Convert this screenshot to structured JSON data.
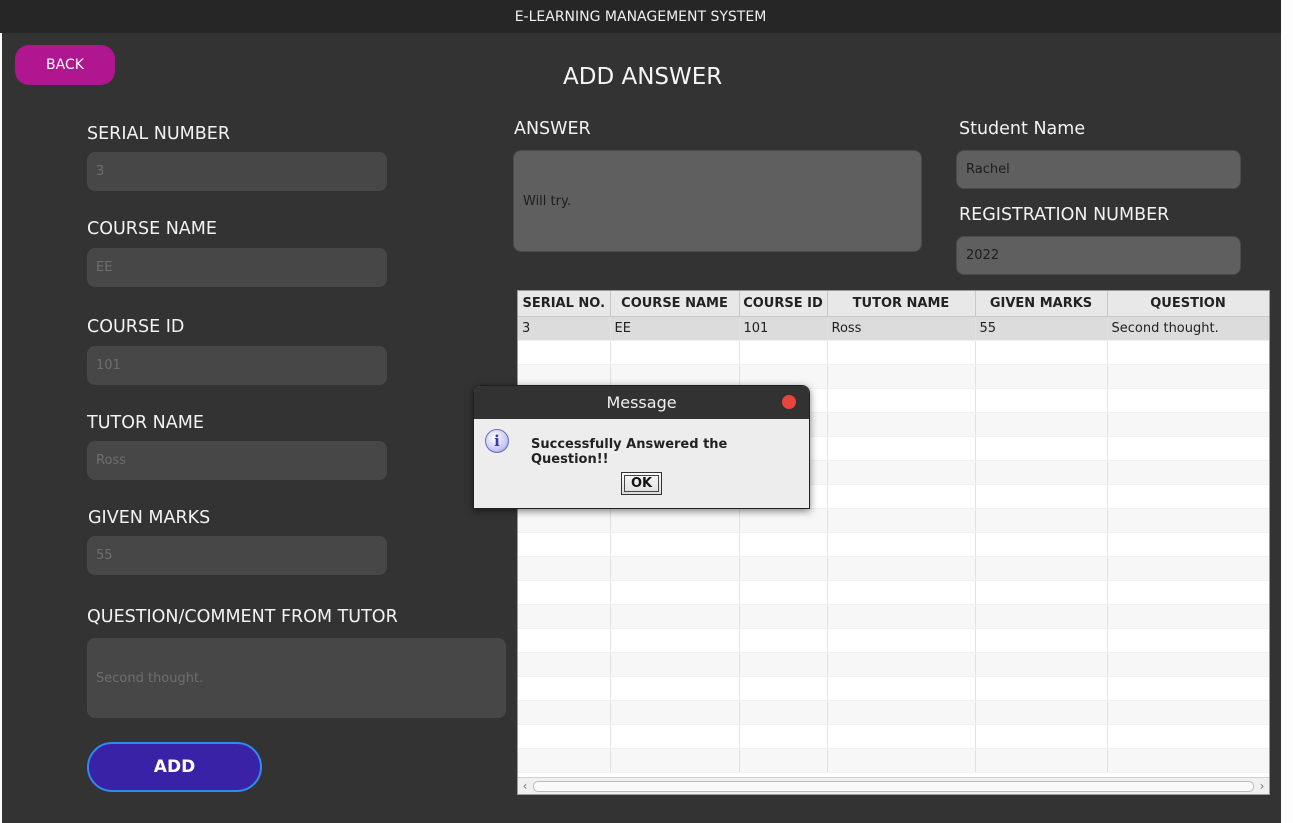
{
  "window": {
    "title": "E-LEARNING MANAGEMENT SYSTEM"
  },
  "back_label": "BACK",
  "page_title": "ADD ANSWER",
  "form": {
    "serial_number": {
      "label": "SERIAL NUMBER",
      "value": "3"
    },
    "course_name": {
      "label": "COURSE NAME",
      "value": "EE"
    },
    "course_id": {
      "label": "COURSE ID",
      "value": "101"
    },
    "tutor_name": {
      "label": "TUTOR NAME",
      "value": "Ross"
    },
    "given_marks": {
      "label": "GIVEN MARKS",
      "value": "55"
    },
    "question": {
      "label": "QUESTION/COMMENT FROM TUTOR",
      "value": "Second thought."
    },
    "answer": {
      "label": "ANSWER",
      "value": "Will try."
    },
    "student_name": {
      "label": "Student Name",
      "value": "Rachel"
    },
    "registration_number": {
      "label": "REGISTRATION NUMBER",
      "value": "2022"
    },
    "add_label": "ADD"
  },
  "table": {
    "columns": [
      "SERIAL NO.",
      "COURSE NAME",
      "COURSE ID",
      "TUTOR NAME",
      "GIVEN MARKS",
      "QUESTION"
    ],
    "rows": [
      [
        "3",
        "EE",
        "101",
        "Ross",
        "55",
        "Second thought."
      ]
    ]
  },
  "dialog": {
    "title": "Message",
    "icon": "info-icon",
    "message": "Successfully Answered the Question!!",
    "ok_label": "OK"
  },
  "colors": {
    "back_button": "#b0168f",
    "add_button": "#3a22a6",
    "add_button_border": "#2f8af0",
    "background": "#333333",
    "close_dot": "#e8453c"
  }
}
